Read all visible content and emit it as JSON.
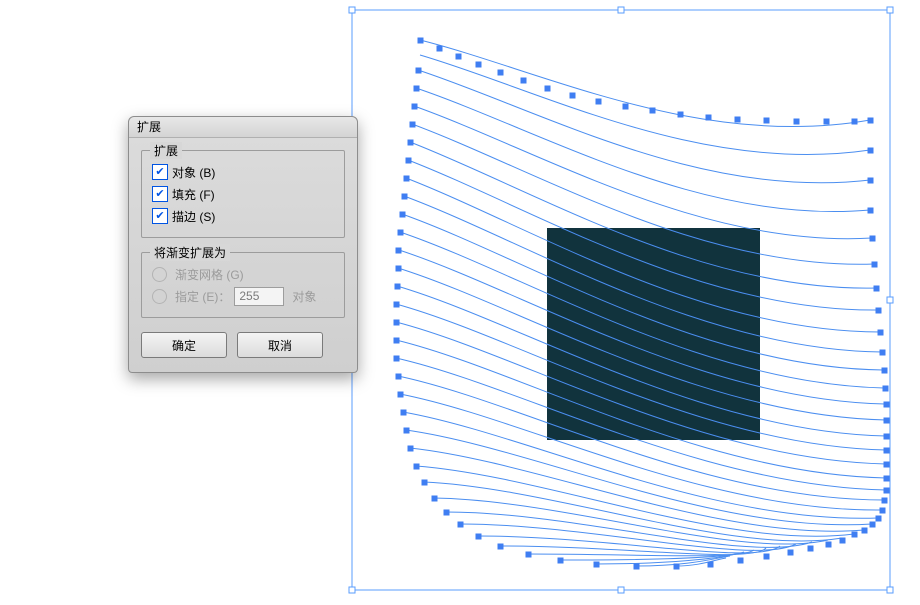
{
  "dialog": {
    "title": "扩展",
    "group1": {
      "legend": "扩展",
      "object_label": "对象 (B)",
      "fill_label": "填充 (F)",
      "stroke_label": "描边 (S)",
      "object_checked": true,
      "fill_checked": true,
      "stroke_checked": true
    },
    "group2": {
      "legend": "将渐变扩展为",
      "mesh_label": "渐变网格 (G)",
      "specify_label_prefix": "指定 (E)：",
      "specify_value": "255",
      "specify_unit": "对象"
    },
    "ok_label": "确定",
    "cancel_label": "取消"
  },
  "colors": {
    "selection": "#4b8ef0",
    "dark_rect": "#11333d"
  }
}
